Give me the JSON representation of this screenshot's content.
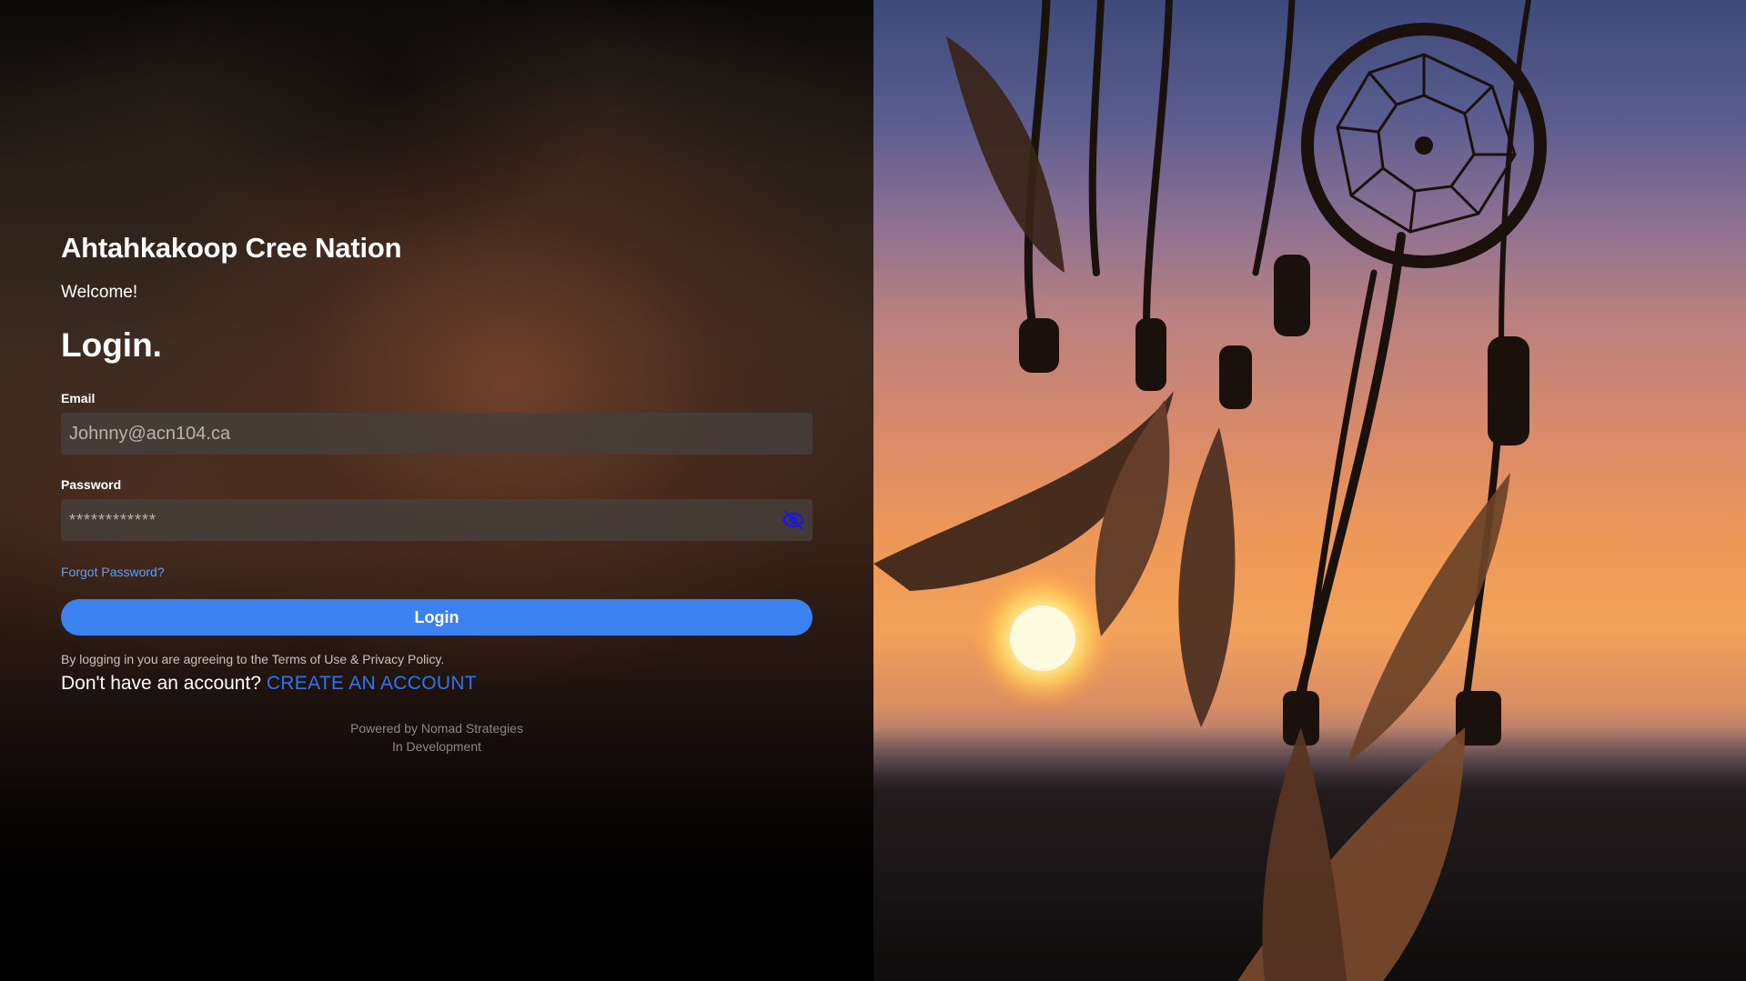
{
  "org": {
    "name": "Ahtahkakoop Cree Nation"
  },
  "greeting": "Welcome!",
  "heading": "Login.",
  "email": {
    "label": "Email",
    "value": "Johnny@acn104.ca"
  },
  "password": {
    "label": "Password",
    "value": "************",
    "toggle_icon": "eye-off-icon"
  },
  "links": {
    "forgot_password": "Forgot Password?",
    "terms_text": "By logging in you are agreeing to the Terms of Use & Privacy Policy.",
    "no_account_text": "Don't have an account?",
    "create_account": "CREATE AN ACCOUNT"
  },
  "login_button": {
    "label": "Login"
  },
  "footer": {
    "powered_by": "Powered by Nomad Strategies",
    "status": "In Development"
  },
  "colors": {
    "accent": "#3b82f0",
    "link": "#5aa2ff",
    "create_account_link": "#2f74f0",
    "eye_icon": "#1a1adf"
  },
  "background_image": {
    "icon": "dreamcatcher-sunset-image"
  }
}
